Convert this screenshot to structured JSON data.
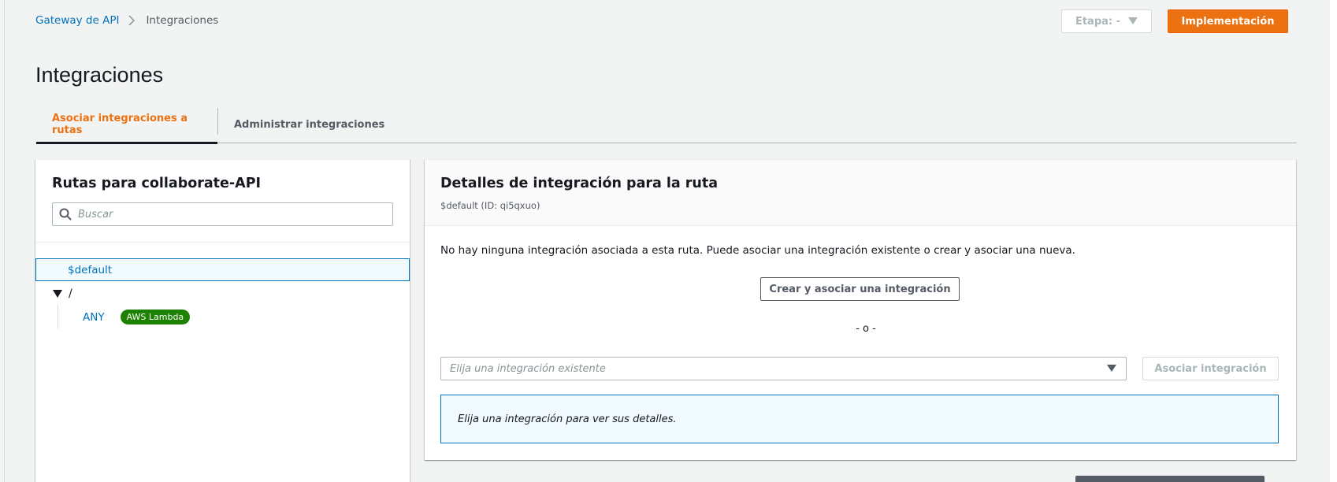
{
  "breadcrumb": {
    "items": [
      {
        "label": "Gateway de API"
      },
      {
        "label": "Integraciones"
      }
    ]
  },
  "header": {
    "stage_label": "Etapa: -",
    "deploy_label": "Implementación"
  },
  "page": {
    "title": "Integraciones"
  },
  "tabs": [
    {
      "label": "Asociar integraciones a rutas",
      "active": true
    },
    {
      "label": "Administrar integraciones",
      "active": false
    }
  ],
  "routes_panel": {
    "title": "Rutas para collaborate-API",
    "search_placeholder": "Buscar",
    "routes": {
      "default": "$default",
      "root": "/",
      "method": "ANY",
      "badge": "AWS Lambda"
    }
  },
  "details_panel": {
    "title": "Detalles de integración para la ruta",
    "subtitle": "$default (ID: qi5qxuo)",
    "message": "No hay ninguna integración asociada a esta ruta. Puede asociar una integración existente o crear y asociar una nueva.",
    "create_button": "Crear y asociar una integración",
    "or_separator": "- o -",
    "select_placeholder": "Elija una integración existente",
    "associate_button": "Asociar integración",
    "info_text": "Elija una integración para ver sus detalles."
  },
  "colors": {
    "accent_orange": "#ec7211",
    "link_blue": "#0073bb",
    "badge_green": "#1d8102"
  }
}
